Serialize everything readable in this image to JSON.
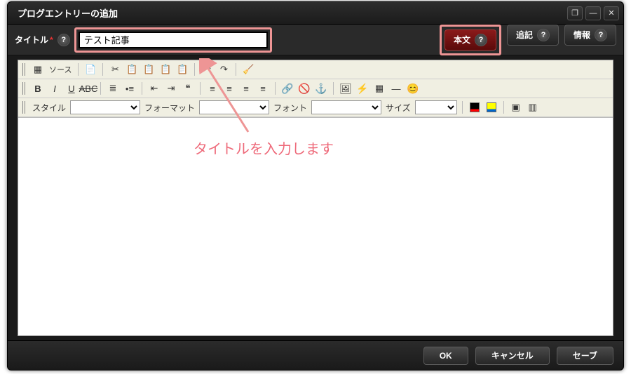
{
  "dialog": {
    "title": "プログエントリーの追加"
  },
  "window_buttons": {
    "maximize": "❐",
    "minimize": "—",
    "close": "✕"
  },
  "form": {
    "title_label": "タイトル",
    "required_mark": "*",
    "title_value": "テスト記事"
  },
  "tabs": {
    "body": "本文",
    "note": "追記",
    "info": "情報"
  },
  "toolbar": {
    "source_label": "ソース",
    "style_label": "スタイル",
    "format_label": "フォーマット",
    "font_label": "フォント",
    "size_label": "サイズ"
  },
  "annotation": {
    "text": "タイトルを入力します"
  },
  "footer": {
    "ok": "OK",
    "cancel": "キャンセル",
    "save": "セーブ"
  }
}
